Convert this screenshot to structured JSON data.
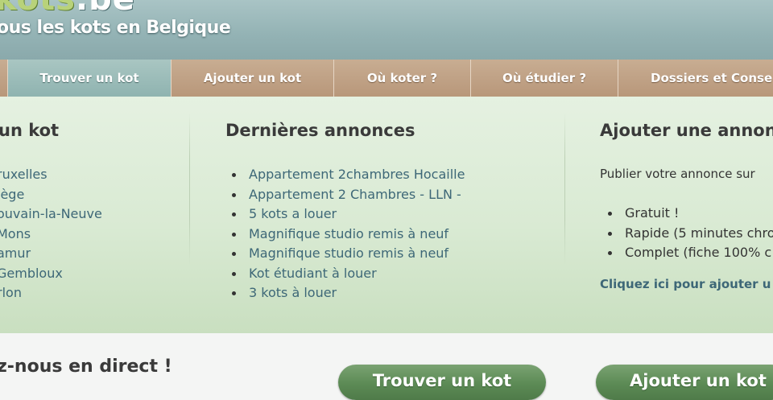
{
  "header": {
    "logo_main": "kots",
    "logo_tld": ".be",
    "tagline": "ous les kots en Belgique"
  },
  "nav": {
    "tabs": [
      {
        "label": "Trouver un kot",
        "active": true
      },
      {
        "label": "Ajouter un kot",
        "active": false
      },
      {
        "label": "Où koter ?",
        "active": false
      },
      {
        "label": "Où étudier ?",
        "active": false
      },
      {
        "label": "Dossiers et Conse",
        "active": false
      }
    ]
  },
  "column_find": {
    "title": "un kot",
    "cities": [
      "ruxelles",
      "iège",
      "ouvain-la-Neuve",
      "Mons",
      "amur",
      "Gembloux",
      "rlon"
    ]
  },
  "column_latest": {
    "title": "Dernières annonces",
    "items": [
      "Appartement 2chambres Hocaille",
      "Appartement 2 Chambres - LLN -",
      "5 kots a louer",
      "Magnifique studio remis à neuf",
      "Magnifique studio remis à neuf",
      "Kot étudiant à louer",
      "3 kots à louer"
    ]
  },
  "column_add": {
    "title": "Ajouter une annon",
    "intro": "Publier votre annonce sur",
    "features": [
      "Gratuit !",
      "Rapide (5 minutes chro",
      "Complet (fiche 100% c"
    ],
    "cta": "Cliquez ici pour ajouter u"
  },
  "bottom": {
    "heading": "z-nous en direct !",
    "btn_find": "Trouver un kot",
    "btn_add": "Ajouter un kot"
  },
  "colors": {
    "header_bg": "#93b2b4",
    "nav_bg": "#b8977a",
    "nav_active": "#8fb3b0",
    "panel_bg": "#d9ead3",
    "link": "#3d6777",
    "button_green": "#5c8a55"
  }
}
